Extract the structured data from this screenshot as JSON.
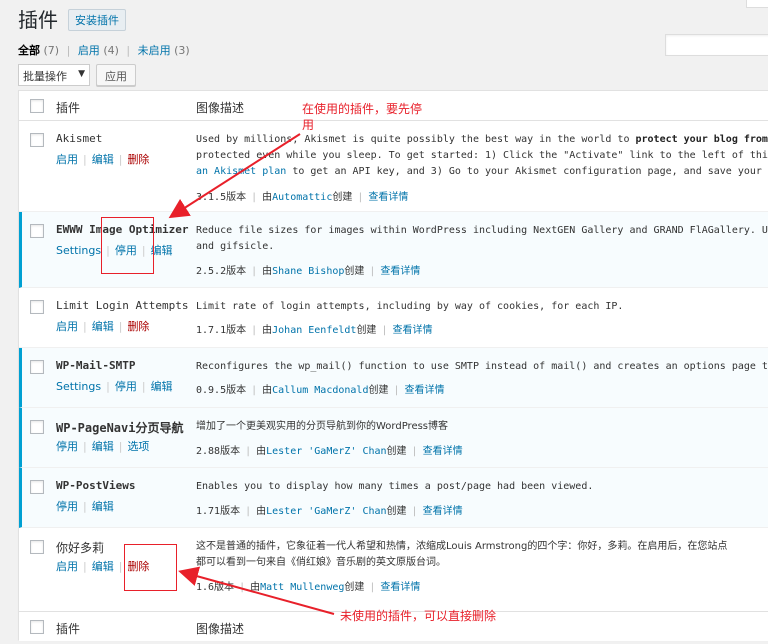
{
  "header": {
    "title": "插件",
    "add_new_label": "安装插件"
  },
  "filters": {
    "all_label": "全部",
    "all_count": "(7)",
    "active_label": "启用",
    "active_count": "(4)",
    "inactive_label": "未启用",
    "inactive_count": "(3)",
    "separator": "|"
  },
  "bulk": {
    "select_value": "批量操作",
    "apply_label": "应用"
  },
  "table": {
    "col_plugin": "插件",
    "col_desc": "图像描述"
  },
  "plugins": [
    {
      "name": "Akismet",
      "actions": [
        "启用",
        "编辑",
        "删除"
      ],
      "desc_lines": [
        "Used by millions, Akismet is quite possibly the best way in the world to ",
        "protected even while you sleep. To get started: 1) Click the \"Activate\" link to the left of this descrip",
        "an Akismet plan to get an API key, and 3) Go to your Akismet configuration page, and save your API key."
      ],
      "desc_bold": "protect your blog from spam.",
      "desc_bold_tail": " It",
      "desc_link_prefix": "an Akismet plan",
      "desc_line3_rest": " to get an API key, and 3) Go to your Akismet configuration page, and save your API key.",
      "version": "3.1.5版本",
      "by": "由",
      "author": "Automattic",
      "created": "创建",
      "details": "查看详情"
    },
    {
      "name": "EWWW Image Optimizer",
      "actions": [
        "Settings",
        "停用",
        "编辑"
      ],
      "desc_lines": [
        "Reduce file sizes for images within WordPress including NextGEN Gallery and GRAND FlAGallery. Uses jpegt",
        "and gifsicle."
      ],
      "version": "2.5.2版本",
      "by": "由",
      "author": "Shane Bishop",
      "created": "创建",
      "details": "查看详情"
    },
    {
      "name": "Limit Login Attempts",
      "actions": [
        "启用",
        "编辑",
        "删除"
      ],
      "desc_lines": [
        "Limit rate of login attempts, including by way of cookies, for each IP."
      ],
      "version": "1.7.1版本",
      "by": "由",
      "author": "Johan Eenfeldt",
      "created": "创建",
      "details": "查看详情"
    },
    {
      "name": "WP-Mail-SMTP",
      "actions": [
        "Settings",
        "停用",
        "编辑"
      ],
      "desc_lines": [
        "Reconfigures the wp_mail() function to use SMTP instead of mail() and creates an options page to manage t"
      ],
      "version": "0.9.5版本",
      "by": "由",
      "author": "Callum Macdonald",
      "created": "创建",
      "details": "查看详情"
    },
    {
      "name": "WP-PageNavi分页导航",
      "actions": [
        "停用",
        "编辑",
        "选项"
      ],
      "desc_lines": [
        "增加了一个更美观实用的分页导航到你的WordPress博客"
      ],
      "version": "2.88版本",
      "by": "由",
      "author": "Lester 'GaMerZ' Chan",
      "created": "创建",
      "details": "查看详情"
    },
    {
      "name": "WP-PostViews",
      "actions": [
        "停用",
        "编辑"
      ],
      "desc_lines": [
        "Enables you to display how many times a post/page had been viewed."
      ],
      "version": "1.71版本",
      "by": "由",
      "author": "Lester 'GaMerZ' Chan",
      "created": "创建",
      "details": "查看详情"
    },
    {
      "name": "你好多莉",
      "actions": [
        "启用",
        "编辑",
        "删除"
      ],
      "desc_lines": [
        "这不是普通的插件，它象征着一代人希望和热情，浓缩成Louis Armstrong的四个字：你好，多莉。在启用后，在您站点",
        "都可以看到一句来自《俏红娘》音乐剧的英文原版台词。"
      ],
      "version": "1.6版本",
      "by": "由",
      "author": "Matt Mullenweg",
      "created": "创建",
      "details": "查看详情"
    }
  ],
  "annotations": {
    "top_note": "在使用的插件，要先停用",
    "bottom_note": "未使用的插件，可以直接删除",
    "color": "#e8202a"
  },
  "colors": {
    "link": "#0073aa",
    "delete": "#a00",
    "active_border": "#00a0d2"
  }
}
